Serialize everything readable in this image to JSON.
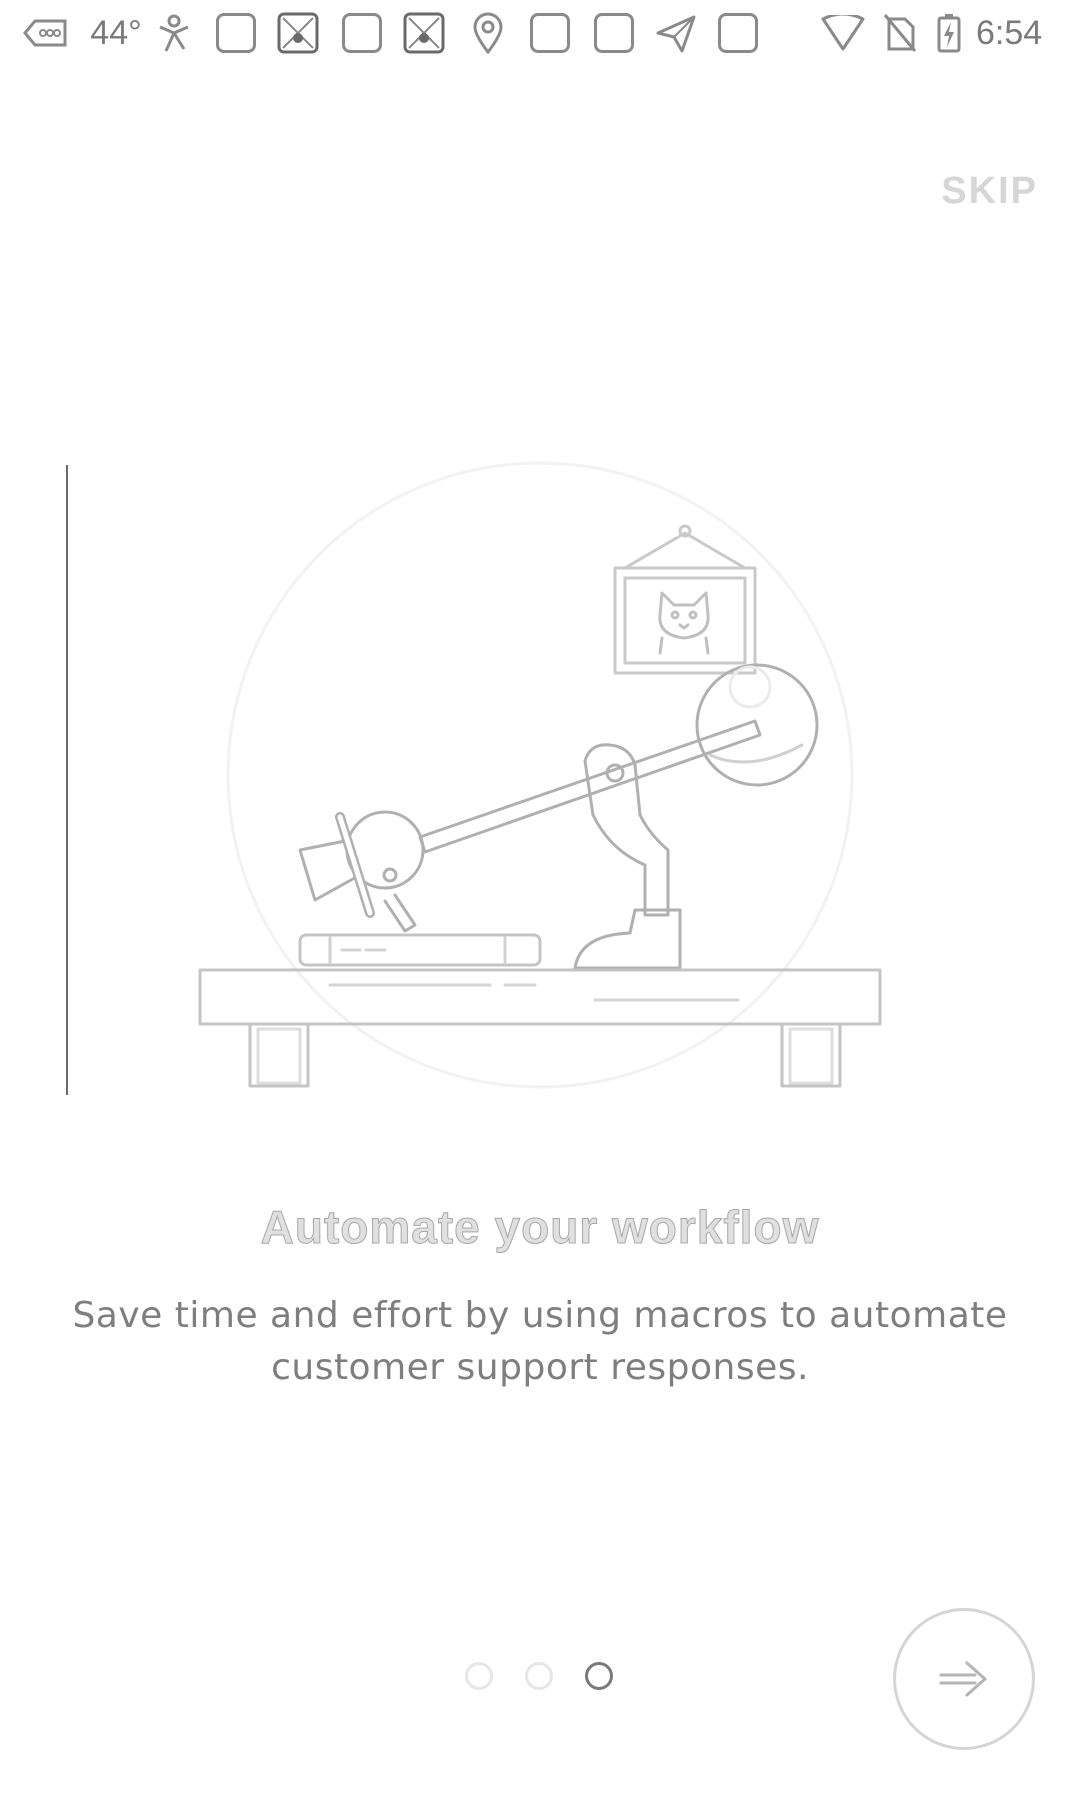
{
  "status_bar": {
    "temperature": "44°",
    "time": "6:54",
    "icons": [
      "carrier-icon",
      "temperature",
      "person-icon",
      "app-icon",
      "tiger-icon",
      "app-icon",
      "tiger-icon",
      "location-pin-icon",
      "app-icon",
      "app-icon",
      "send-icon",
      "app-icon",
      "wifi-icon",
      "no-sim-icon",
      "battery-icon"
    ]
  },
  "onboarding": {
    "skip_label": "SKIP",
    "title": "Automate your workflow",
    "description": "Save time and effort by using macros to automate customer support responses.",
    "pager": {
      "total": 3,
      "active_index": 2
    },
    "next_icon": "arrow-right-icon"
  },
  "colors": {
    "background": "#ffffff",
    "text_gray": "#7e7e7e",
    "light_gray": "#d6d6d6",
    "active_dot": "#7a7a7a"
  }
}
